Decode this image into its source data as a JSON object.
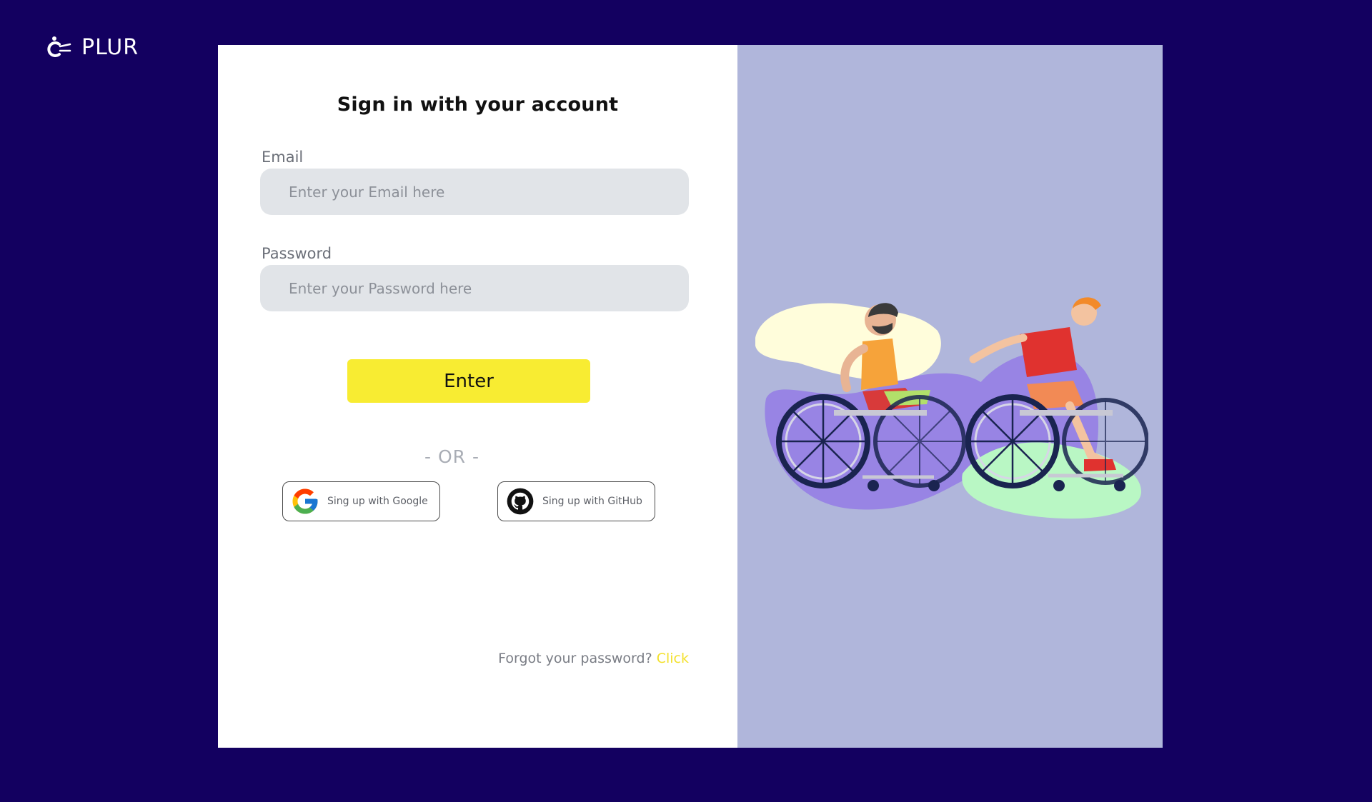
{
  "brand": {
    "name": "PLUR",
    "icon": "plur-logo-icon"
  },
  "form": {
    "title": "Sign in with your account",
    "email": {
      "label": "Email",
      "placeholder": "Enter your Email here",
      "value": ""
    },
    "password": {
      "label": "Password",
      "placeholder": "Enter your Password here",
      "value": ""
    },
    "submit_label": "Enter",
    "divider": "- OR -",
    "social": [
      {
        "label": "Sing up with Google",
        "icon": "google-icon"
      },
      {
        "label": "Sing up with GitHub",
        "icon": "github-icon"
      }
    ],
    "forgot": {
      "text": "Forgot your password?",
      "link_label": "Click"
    }
  },
  "illustration": {
    "icon": "wheelchair-racers-illustration"
  },
  "colors": {
    "page_background": "#130060",
    "card_background": "#ffffff",
    "art_panel": "#b0b6db",
    "accent_yellow": "#f8ec32",
    "input_background": "#e1e4e8"
  }
}
